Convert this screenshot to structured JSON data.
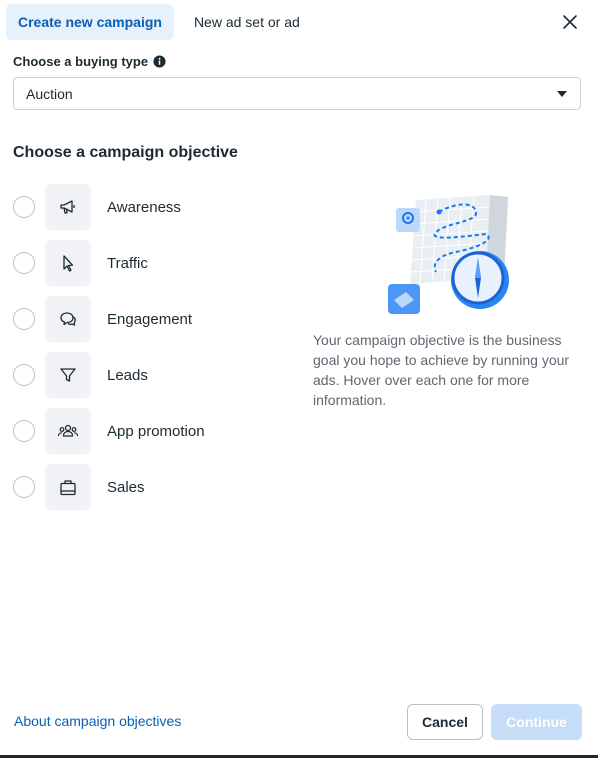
{
  "tabs": [
    {
      "label": "Create new campaign",
      "active": true
    },
    {
      "label": "New ad set or ad",
      "active": false
    }
  ],
  "icons": {
    "close": "close-icon",
    "info": "info-icon",
    "caret": "caret-down-icon"
  },
  "buying_type": {
    "label": "Choose a buying type",
    "value": "Auction"
  },
  "objective_section": {
    "title": "Choose a campaign objective",
    "objectives": [
      {
        "label": "Awareness",
        "icon": "megaphone-icon"
      },
      {
        "label": "Traffic",
        "icon": "cursor-icon"
      },
      {
        "label": "Engagement",
        "icon": "chat-bubbles-icon"
      },
      {
        "label": "Leads",
        "icon": "funnel-icon"
      },
      {
        "label": "App promotion",
        "icon": "people-icon"
      },
      {
        "label": "Sales",
        "icon": "shopping-bag-icon"
      }
    ],
    "description": "Your campaign objective is the business goal you hope to achieve by running your ads. Hover over each one for more information."
  },
  "footer": {
    "link": "About campaign objectives",
    "cancel_label": "Cancel",
    "continue_label": "Continue"
  },
  "colors": {
    "accent": "#0a5fb4",
    "tab_active_bg": "#e7f1fb",
    "continue_disabled": "#c5ddf6",
    "text": "#1c2b33",
    "muted": "#606770"
  }
}
